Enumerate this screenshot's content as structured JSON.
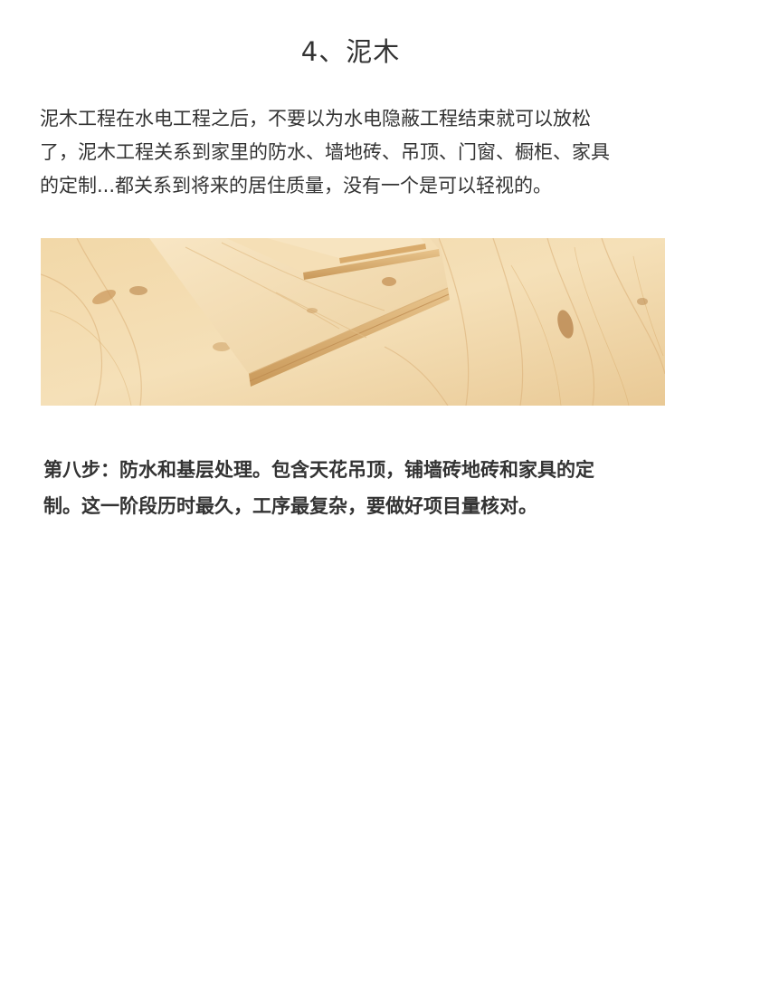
{
  "section": {
    "heading": "4、泥木"
  },
  "intro": {
    "lines": [
      "泥木工程在水电工程之后，不要以为水电隐蔽工程结束就可以放松",
      "了，泥木工程关系到家里的防水、墙地砖、吊顶、门窗、橱柜、家具",
      "的定制...都关系到将来的居住质量，没有一个是可以轻视的。"
    ]
  },
  "photo": {
    "subject": "wood-planks",
    "colors": {
      "light": "#f3dcb0",
      "mid": "#e6c28c",
      "dark": "#c99a5c",
      "knot": "#a8743e"
    }
  },
  "step": {
    "lines": [
      "第八步：防水和基层处理。包含天花吊顶，铺墙砖地砖和家具的定",
      "制。这一阶段历时最久，工序最复杂，要做好项目量核对。"
    ]
  }
}
